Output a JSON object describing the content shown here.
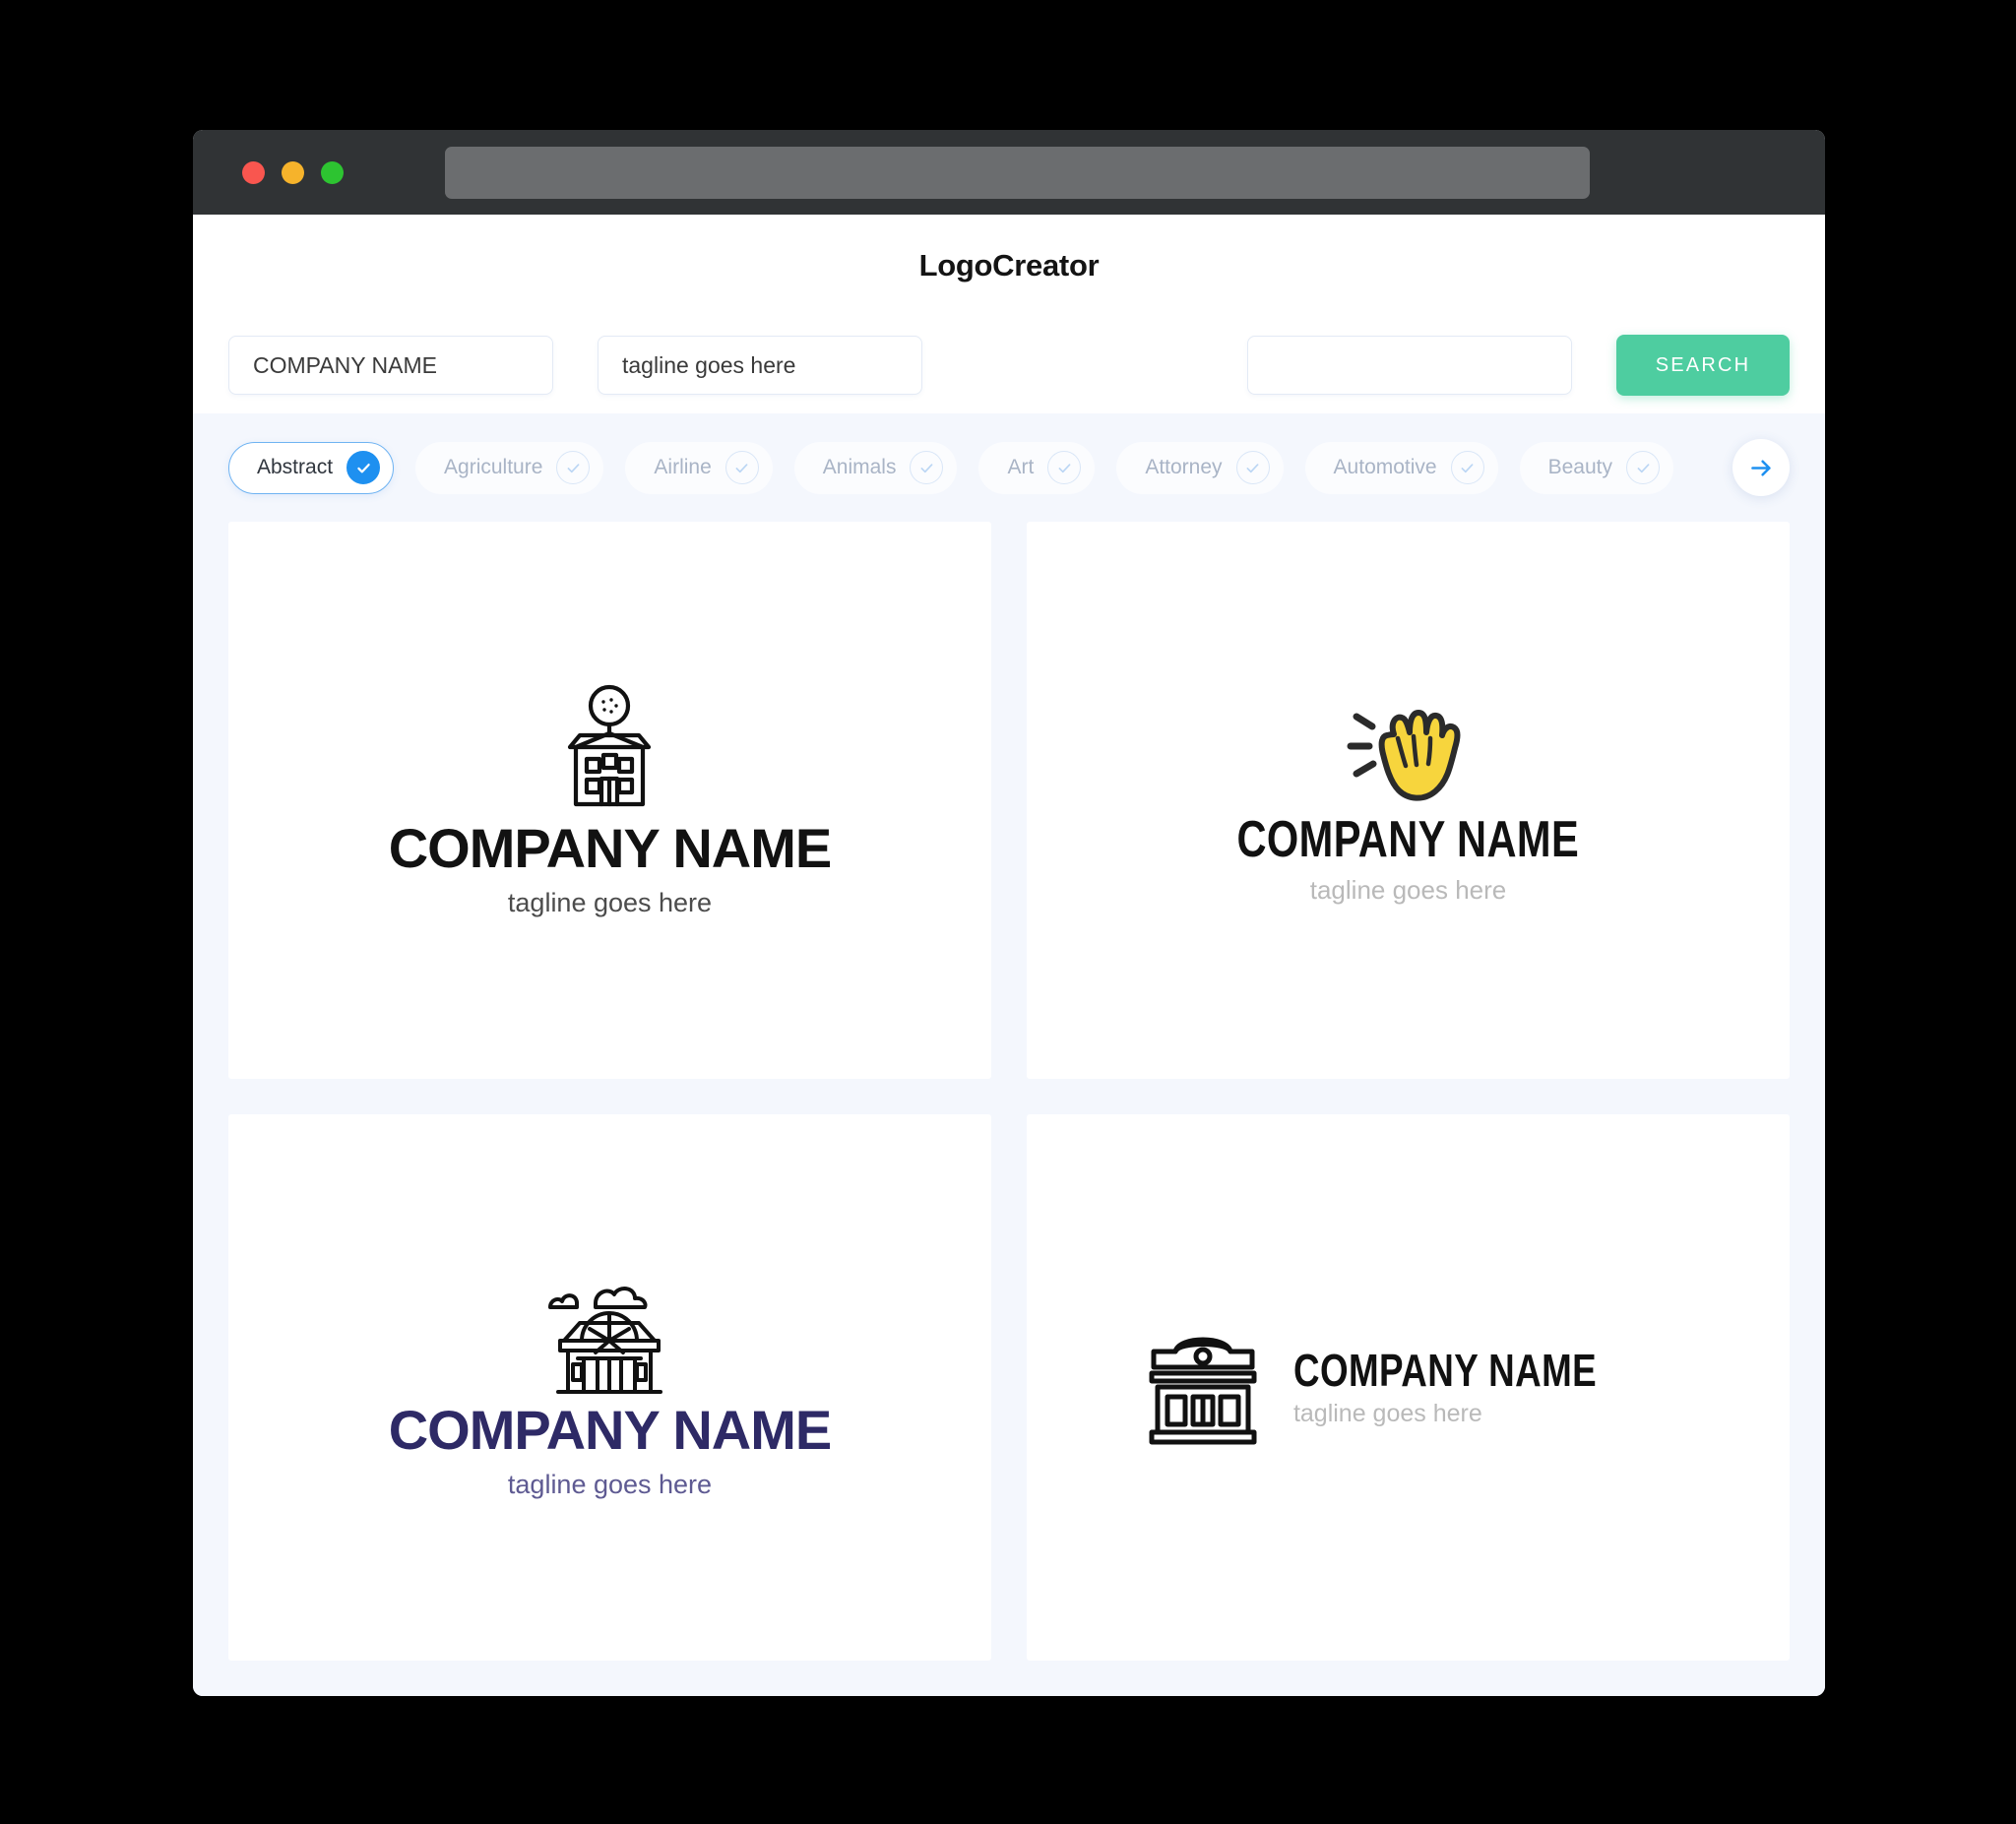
{
  "window": {
    "traffic_lights": [
      "close",
      "minimize",
      "maximize"
    ],
    "url_value": ""
  },
  "header": {
    "brand": "LogoCreator"
  },
  "search": {
    "company_value": "COMPANY NAME",
    "company_placeholder": "COMPANY NAME",
    "tagline_value": "tagline goes here",
    "tagline_placeholder": "tagline goes here",
    "third_value": "",
    "third_placeholder": "",
    "search_label": "SEARCH",
    "search_color": "#4ECDA0"
  },
  "categories": {
    "accent_selected": "#1E90F0",
    "next_label": "next-categories",
    "items": [
      {
        "label": "Abstract",
        "selected": true
      },
      {
        "label": "Agriculture",
        "selected": false
      },
      {
        "label": "Airline",
        "selected": false
      },
      {
        "label": "Animals",
        "selected": false
      },
      {
        "label": "Art",
        "selected": false
      },
      {
        "label": "Attorney",
        "selected": false
      },
      {
        "label": "Automotive",
        "selected": false
      },
      {
        "label": "Beauty",
        "selected": false
      }
    ]
  },
  "logos": [
    {
      "icon": "house-with-tree-icon",
      "name": "COMPANY NAME",
      "tagline": "tagline goes here",
      "name_color": "#121212",
      "tagline_color": "#4C4C4C",
      "layout": "stacked"
    },
    {
      "icon": "waving-hand-icon",
      "name": "COMPANY NAME",
      "tagline": "tagline goes here",
      "name_color": "#111111",
      "tagline_color": "#B9B9B9",
      "layout": "stacked"
    },
    {
      "icon": "pavilion-with-clouds-icon",
      "name": "COMPANY NAME",
      "tagline": "tagline goes here",
      "name_color": "#2E2A66",
      "tagline_color": "#5E5A92",
      "layout": "stacked"
    },
    {
      "icon": "bank-building-icon",
      "name": "COMPANY NAME",
      "tagline": "tagline goes here",
      "name_color": "#111111",
      "tagline_color": "#B9B9B9",
      "layout": "horizontal"
    }
  ]
}
